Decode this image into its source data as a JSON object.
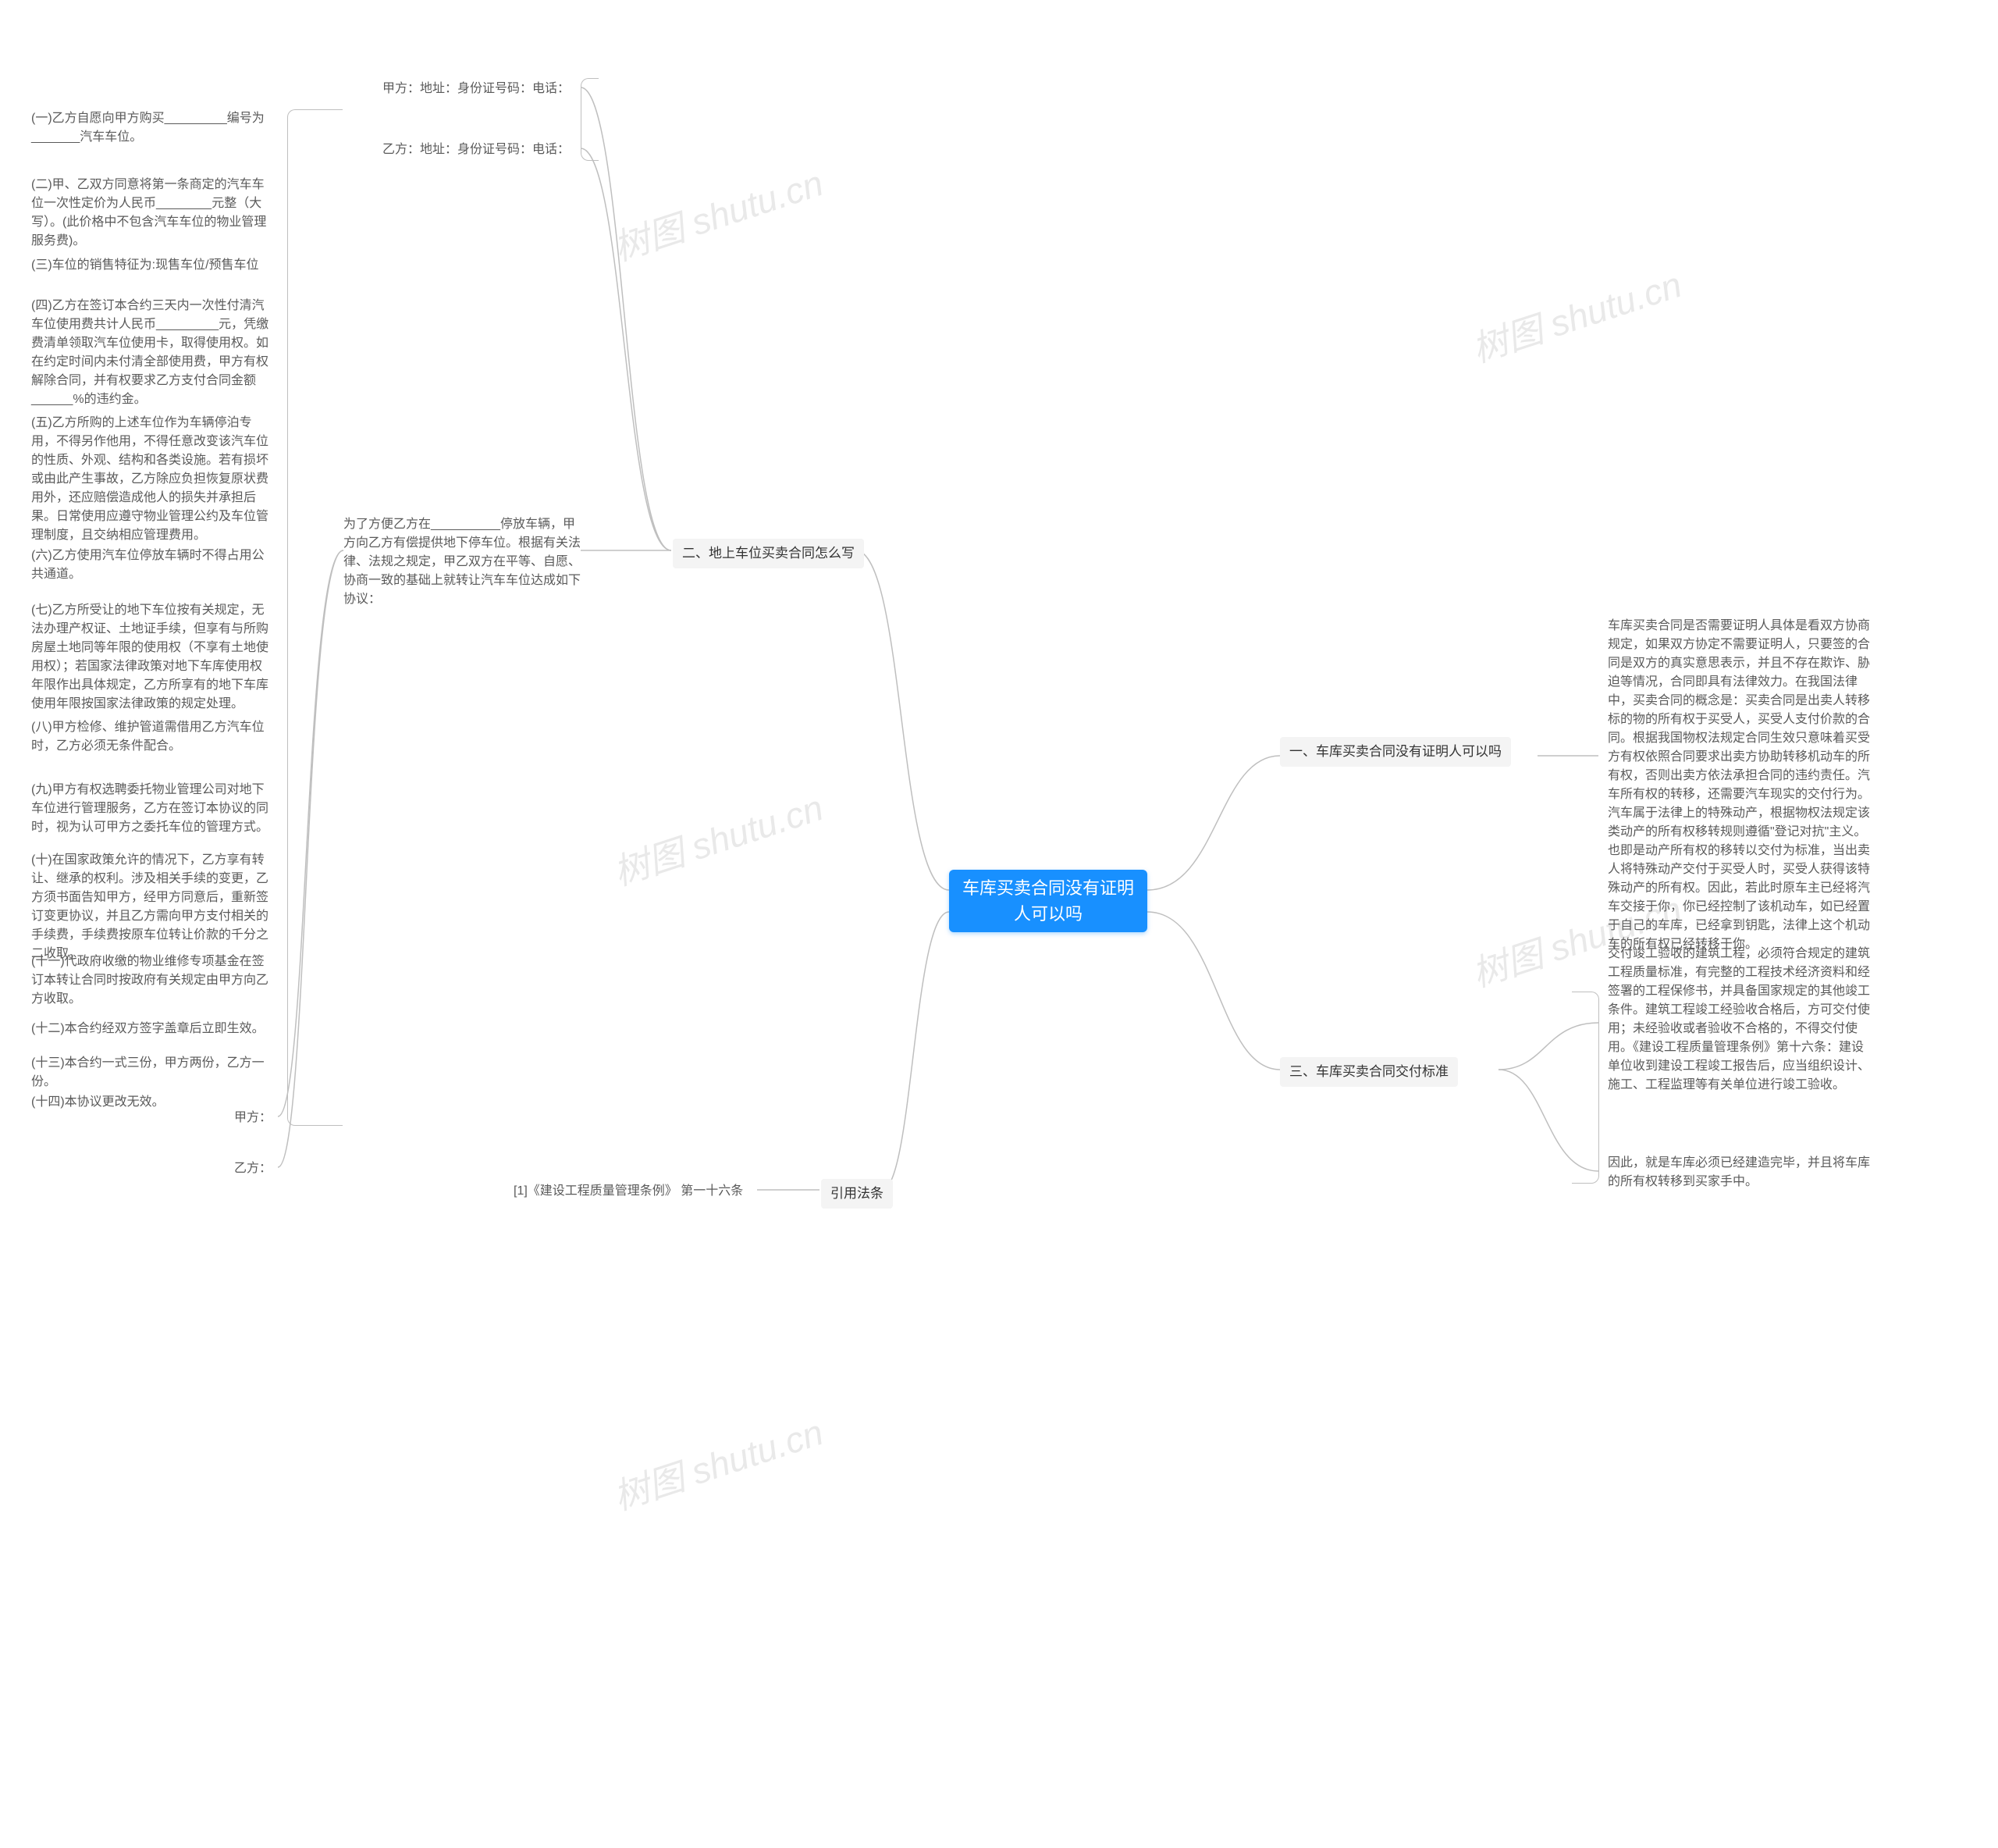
{
  "watermark": "树图 shutu.cn",
  "root": "车库买卖合同没有证明人可以吗",
  "sections": {
    "s1": {
      "title": "一、车库买卖合同没有证明人可以吗",
      "body": "车库买卖合同是否需要证明人具体是看双方协商规定，如果双方协定不需要证明人，只要签的合同是双方的真实意思表示，并且不存在欺诈、胁迫等情况，合同即具有法律效力。在我国法律中，买卖合同的概念是：买卖合同是出卖人转移标的物的所有权于买受人，买受人支付价款的合同。根据我国物权法规定合同生效只意味着买受方有权依照合同要求出卖方协助转移机动车的所有权，否则出卖方依法承担合同的违约责任。汽车所有权的转移，还需要汽车现实的交付行为。汽车属于法律上的特殊动产，根据物权法规定该类动产的所有权移转规则遵循\"登记对抗\"主义。也即是动产所有权的移转以交付为标准，当出卖人将特殊动产交付于买受人时，买受人获得该特殊动产的所有权。因此，若此时原车主已经将汽车交接于你，你已经控制了该机动车，如已经置于自己的车库，已经拿到钥匙，法律上这个机动车的所有权已经转移于你。"
    },
    "s2": {
      "title": "二、地上车位买卖合同怎么写",
      "partyA": "甲方：地址：身份证号码：电话：",
      "partyB": "乙方：地址：身份证号码：电话：",
      "intro": "为了方便乙方在__________停放车辆，甲方向乙方有偿提供地下停车位。根据有关法律、法规之规定，甲乙双方在平等、自愿、协商一致的基础上就转让汽车车位达成如下协议：",
      "clauses": [
        "(一)乙方自愿向甲方购买_________编号为_______汽车车位。",
        "(二)甲、乙双方同意将第一条商定的汽车车位一次性定价为人民币________元整（大写）。(此价格中不包含汽车车位的物业管理服务费)。",
        "(三)车位的销售特征为:现售车位/预售车位",
        "(四)乙方在签订本合约三天内一次性付清汽车位使用费共计人民币_________元，凭缴费清单领取汽车位使用卡，取得使用权。如在约定时间内未付清全部使用费，甲方有权解除合同，并有权要求乙方支付合同金额______%的违约金。",
        "(五)乙方所购的上述车位作为车辆停泊专用，不得另作他用，不得任意改变该汽车位的性质、外观、结构和各类设施。若有损坏或由此产生事故，乙方除应负担恢复原状费用外，还应赔偿造成他人的损失并承担后果。日常使用应遵守物业管理公约及车位管理制度，且交纳相应管理费用。",
        "(六)乙方使用汽车位停放车辆时不得占用公共通道。",
        "(七)乙方所受让的地下车位按有关规定，无法办理产权证、土地证手续，但享有与所购房屋土地同等年限的使用权（不享有土地使用权）；若国家法律政策对地下车库使用权年限作出具体规定，乙方所享有的地下车库使用年限按国家法律政策的规定处理。",
        "(八)甲方检修、维护管道需借用乙方汽车位时，乙方必须无条件配合。",
        "(九)甲方有权选聘委托物业管理公司对地下车位进行管理服务，乙方在签订本协议的同时，视为认可甲方之委托车位的管理方式。",
        "(十)在国家政策允许的情况下，乙方享有转让、继承的权利。涉及相关手续的变更，乙方须书面告知甲方，经甲方同意后，重新签订变更协议，并且乙方需向甲方支付相关的手续费，手续费按原车位转让价款的千分之二收取。",
        "(十一)代政府收缴的物业维修专项基金在签订本转让合同时按政府有关规定由甲方向乙方收取。",
        "(十二)本合约经双方签字盖章后立即生效。",
        "(十三)本合约一式三份，甲方两份，乙方一份。",
        "(十四)本协议更改无效。"
      ],
      "signA": "甲方：",
      "signB": "乙方："
    },
    "s3": {
      "title": "三、车库买卖合同交付标准",
      "body1": "交付竣工验收的建筑工程，必须符合规定的建筑工程质量标准，有完整的工程技术经济资料和经签署的工程保修书，并具备国家规定的其他竣工条件。建筑工程竣工经验收合格后，方可交付使用；未经验收或者验收不合格的，不得交付使用。《建设工程质量管理条例》第十六条：建设单位收到建设工程竣工报告后，应当组织设计、施工、工程监理等有关单位进行竣工验收。",
      "body2": "因此，就是车库必须已经建造完毕，并且将车库的所有权转移到买家手中。"
    },
    "refs": {
      "title": "引用法条",
      "item": "[1]《建设工程质量管理条例》 第一十六条"
    }
  }
}
